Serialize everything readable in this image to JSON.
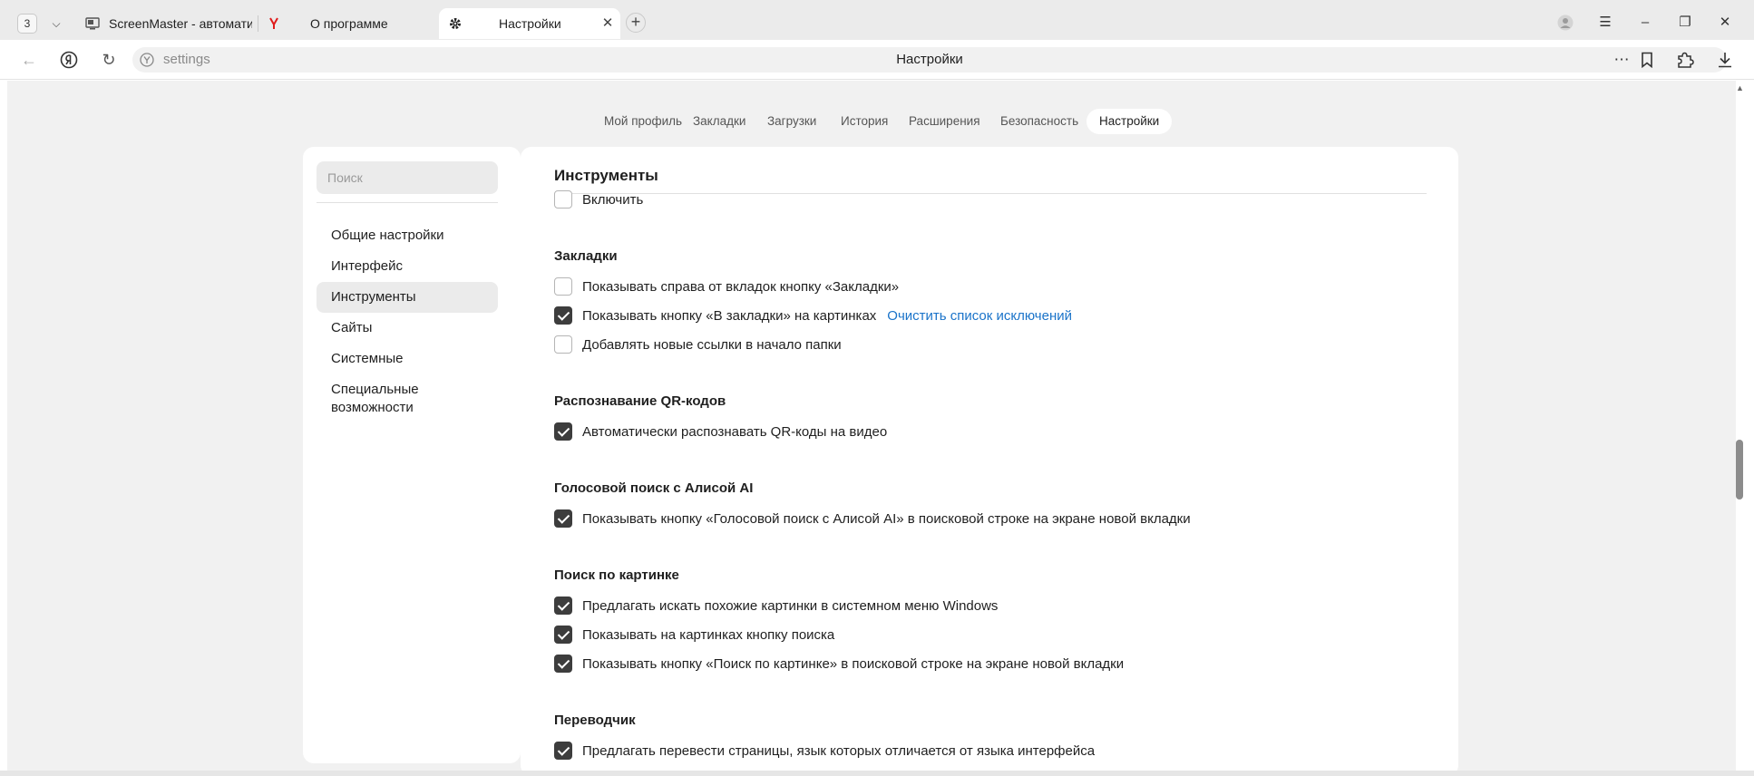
{
  "browser": {
    "tab_count": "3",
    "tabs": [
      {
        "title": "ScreenMaster - автомати"
      },
      {
        "title": "О программе"
      },
      {
        "title": "Настройки"
      }
    ],
    "new_tab": "+",
    "address": {
      "url": "settings",
      "page_title": "Настройки"
    }
  },
  "page_nav": {
    "items": [
      {
        "label": "Мой профиль"
      },
      {
        "label": "Закладки"
      },
      {
        "label": "Загрузки"
      },
      {
        "label": "История"
      },
      {
        "label": "Расширения"
      },
      {
        "label": "Безопасность"
      },
      {
        "label": "Настройки"
      }
    ],
    "active": "Настройки"
  },
  "sidebar": {
    "search_placeholder": "Поиск",
    "items": [
      {
        "label": "Общие настройки"
      },
      {
        "label": "Интерфейс"
      },
      {
        "label": "Инструменты"
      },
      {
        "label": "Сайты"
      },
      {
        "label": "Системные"
      },
      {
        "label": "Специальные возможности"
      }
    ],
    "active": "Инструменты"
  },
  "content": {
    "title": "Инструменты",
    "top_option": {
      "label": "Включить",
      "checked": false
    },
    "sections": [
      {
        "heading": "Закладки",
        "options": [
          {
            "label": "Показывать справа от вкладок кнопку «Закладки»",
            "checked": false
          },
          {
            "label": "Показывать кнопку «В закладки» на картинках",
            "checked": true,
            "link": "Очистить список исключений"
          },
          {
            "label": "Добавлять новые ссылки в начало папки",
            "checked": false
          }
        ]
      },
      {
        "heading": "Распознавание QR-кодов",
        "options": [
          {
            "label": "Автоматически распознавать QR-коды на видео",
            "checked": true
          }
        ]
      },
      {
        "heading": "Голосовой поиск с Алисой AI",
        "options": [
          {
            "label": "Показывать кнопку «Голосовой поиск с Алисой AI» в поисковой строке на экране новой вкладки",
            "checked": true
          }
        ]
      },
      {
        "heading": "Поиск по картинке",
        "options": [
          {
            "label": "Предлагать искать похожие картинки в системном меню Windows",
            "checked": true
          },
          {
            "label": "Показывать на картинках кнопку поиска",
            "checked": true
          },
          {
            "label": "Показывать кнопку «Поиск по картинке» в поисковой строке на экране новой вкладки",
            "checked": true
          }
        ]
      },
      {
        "heading": "Переводчик",
        "options": [
          {
            "label": "Предлагать перевести страницы, язык которых отличается от языка интерфейса",
            "checked": true
          }
        ]
      }
    ]
  },
  "colors": {
    "link": "#1a73c9",
    "checkbox_checked": "#3d3d3d",
    "page_background": "#f1f1f1"
  }
}
